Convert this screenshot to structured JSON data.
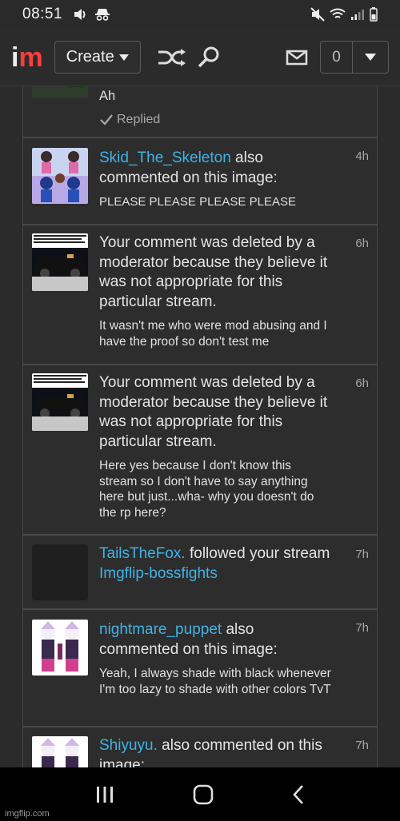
{
  "status_bar": {
    "time": "08:51"
  },
  "header": {
    "logo_i": "i",
    "logo_m": "m",
    "create_label": "Create",
    "notification_count": "0"
  },
  "notifications": [
    {
      "body": "Ah",
      "replied_label": "Replied"
    },
    {
      "user": "Skid_The_Skeleton",
      "action": " also commented on this image:",
      "body": "PLEASE PLEASE PLEASE PLEASE",
      "time": "4h"
    },
    {
      "title": "Your comment was deleted by a moderator because they believe it was not appropriate for this particular stream.",
      "body": "It wasn't me who were mod abusing and I have the proof so don't test me",
      "time": "6h"
    },
    {
      "title": "Your comment was deleted by a moderator because they believe it was not appropriate for this particular stream.",
      "body": "Here yes because I don't know this stream so I don't have to say anything here but just...wha- why you doesn't do the rp here?",
      "time": "6h"
    },
    {
      "user": "TailsTheFox.",
      "action": " followed your stream ",
      "stream": "Imgflip-bossfights",
      "time": "7h"
    },
    {
      "user": "nightmare_puppet",
      "action": " also commented on this image:",
      "body": "Yeah, I always shade with black whenever I'm too lazy to shade with other colors TvT",
      "time": "7h"
    },
    {
      "user": "Shiyuyu.",
      "action": " also commented on this image:",
      "time": "7h"
    }
  ],
  "watermark": "imgflip.com"
}
